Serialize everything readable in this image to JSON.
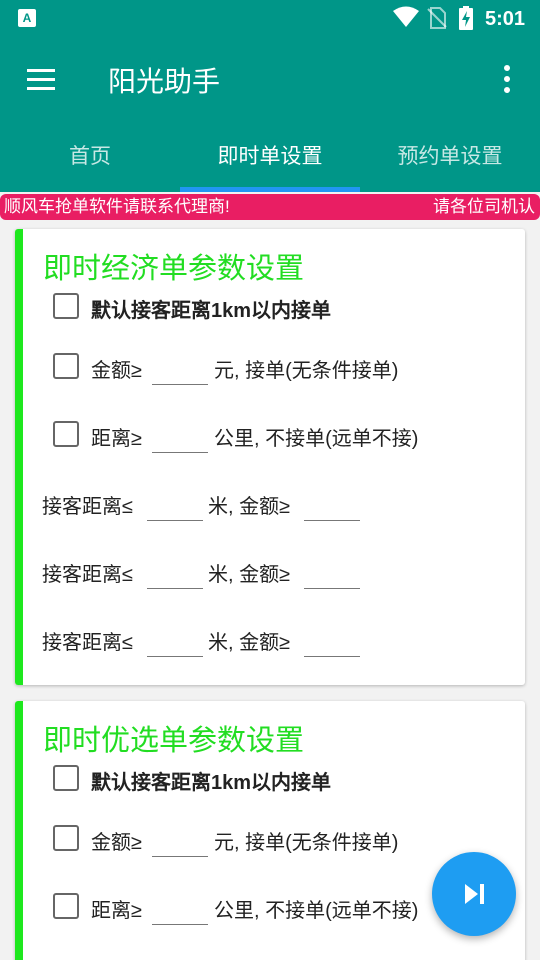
{
  "status_bar": {
    "time": "5:01",
    "app_icon_letter": "A"
  },
  "app_bar": {
    "title": "阳光助手"
  },
  "tabs": [
    {
      "label": "首页"
    },
    {
      "label": "即时单设置",
      "active": true
    },
    {
      "label": "预约单设置"
    }
  ],
  "marquee": {
    "text1": "顺风车抢单软件请联系代理商!",
    "text2": "请各位司机认"
  },
  "cards": [
    {
      "title": "即时经济单参数设置",
      "default_label": "默认接客距离1km以内接单",
      "amount_prefix": "金额≥",
      "amount_suffix": "元, 接单(无条件接单)",
      "distance_prefix": "距离≥",
      "distance_suffix": "公里, 不接单(远单不接)",
      "pickup_rules": [
        {
          "prefix": "接客距离≤",
          "middle": "米, 金额≥"
        },
        {
          "prefix": "接客距离≤",
          "middle": "米, 金额≥"
        },
        {
          "prefix": "接客距离≤",
          "middle": "米, 金额≥"
        }
      ]
    },
    {
      "title": "即时优选单参数设置",
      "default_label": "默认接客距离1km以内接单",
      "amount_prefix": "金额≥",
      "amount_suffix": "元, 接单(无条件接单)",
      "distance_prefix": "距离≥",
      "distance_suffix": "公里, 不接单(远单不接)"
    }
  ],
  "colors": {
    "primary": "#009688",
    "tab_indicator": "#2196f3",
    "marquee": "#e91e63",
    "card_accent": "#1ee81e",
    "card_title": "#22dd22",
    "fab": "#1e9df2"
  },
  "icons": {
    "menu": "menu-icon",
    "more": "more-vert-icon",
    "fab": "skip-next-icon",
    "wifi": "wifi-icon",
    "sim": "no-sim-icon",
    "battery": "battery-charging-icon"
  }
}
